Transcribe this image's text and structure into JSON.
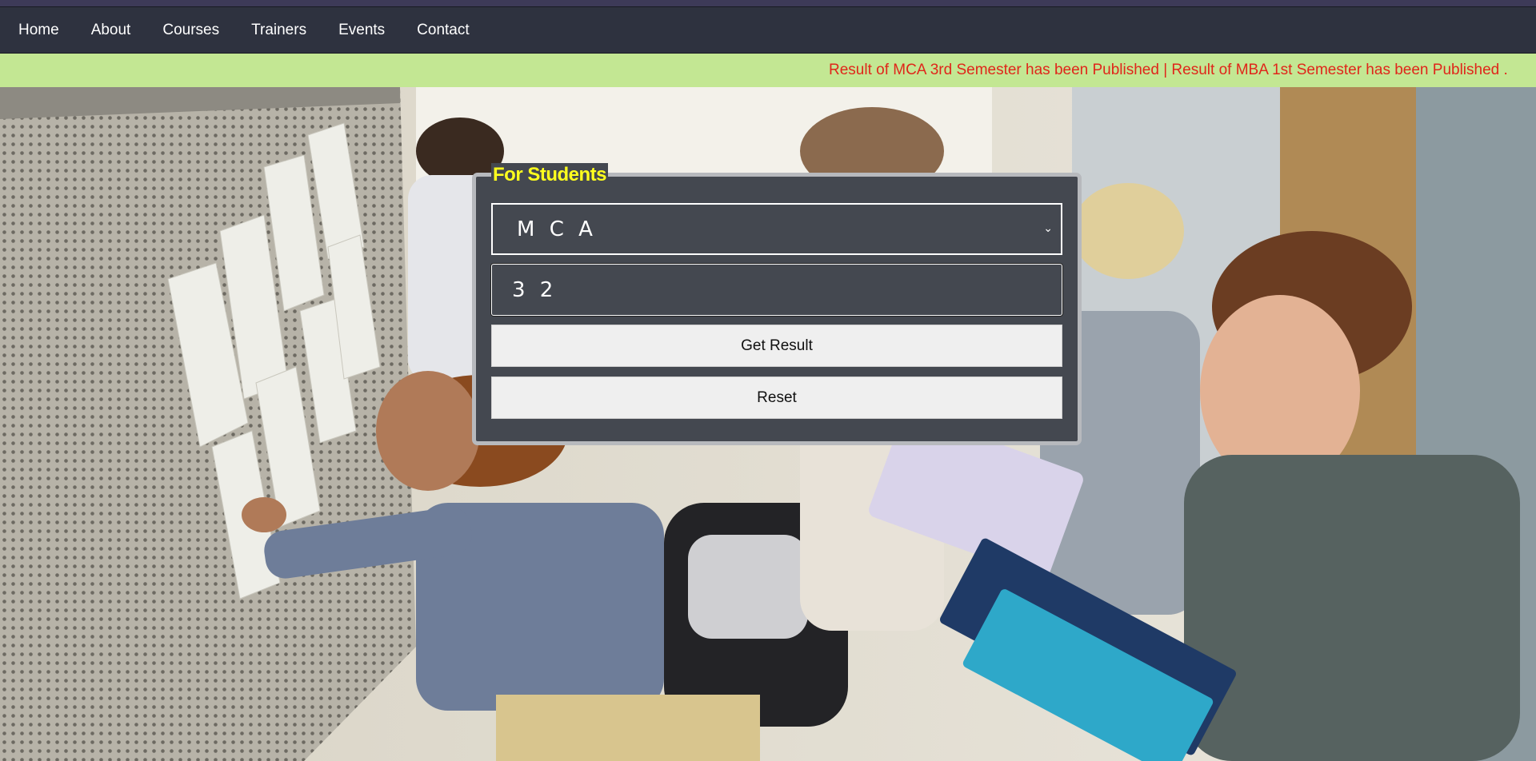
{
  "nav": {
    "items": [
      {
        "label": "Home"
      },
      {
        "label": "About"
      },
      {
        "label": "Courses"
      },
      {
        "label": "Trainers"
      },
      {
        "label": "Events"
      },
      {
        "label": "Contact"
      }
    ]
  },
  "ticker": {
    "text": "Result of MCA 3rd Semester has been Published | Result of MBA 1st Semester has been Published .",
    "color": "#e0261a",
    "background": "#c3e793"
  },
  "form": {
    "legend": "For Students",
    "course_select": {
      "selected": "MCA",
      "display": "M C A"
    },
    "roll_input": {
      "value": "32",
      "display": "3 2"
    },
    "submit_label": "Get Result",
    "reset_label": "Reset"
  },
  "colors": {
    "navbar": "#2e323f",
    "panel": "#444850",
    "legend": "#ffff1e"
  }
}
